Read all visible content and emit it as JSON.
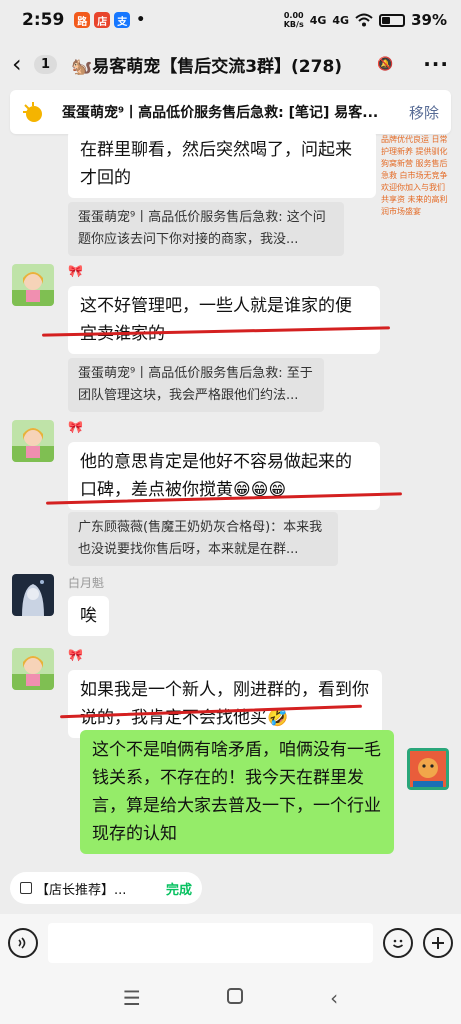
{
  "status": {
    "time": "2:59",
    "speed": "0.00\nKB/s",
    "signal1": "4G",
    "signal2": "4G",
    "battery": "39%"
  },
  "header": {
    "unread": "1",
    "title": "🐿️易客萌宠【售后交流3群】(278)",
    "more": "···"
  },
  "pinned": {
    "text": "蛋蛋萌宠⁹丨高品低价服务售后急救: [笔记] 易客...",
    "remove": "移除"
  },
  "messages": {
    "m0": {
      "text": "在群里聊看，然后突然喝了，问起来才回的"
    },
    "q0": {
      "text": "蛋蛋萌宠⁹丨高品低价服务售后急救: 这个问题你应该去问下你对接的商家，我没..."
    },
    "n1": {
      "nick": "🎀"
    },
    "m1": {
      "text": "这不好管理吧，一些人就是谁家的便宜卖谁家的"
    },
    "q1": {
      "text": "蛋蛋萌宠⁹丨高品低价服务售后急救: 至于团队管理这块，我会严格跟他们约法..."
    },
    "n2": {
      "nick": "🎀"
    },
    "m2": {
      "text": "他的意思肯定是他好不容易做起来的口碑，差点被你搅黄😁😁😁"
    },
    "q2": {
      "text": "广东顾薇薇(售魔王奶奶灰合格母)：本来我也没说要找你售后呀，本来就是在群..."
    },
    "n3": {
      "nick": "白月魁"
    },
    "m3": {
      "text": "唉"
    },
    "n4": {
      "nick": "🎀"
    },
    "m4": {
      "text": "如果我是一个新人，刚进群的，看到你说的，我肯定不会找他买🤣"
    },
    "m5": {
      "text": "这个不是咱俩有啥矛盾，咱俩没有一毛钱关系，不存在的！我今天在群里发言，算是给大家去普及一下，一个行业现存的认知"
    }
  },
  "peek_text": "品牌优代良运 日常护理新养 提供驯化狗窝新营 服务售后急救 白市场无竞争 欢迎你加入与我们共享资 未来的高利润市场盛宴",
  "quick": {
    "label": "【店长推荐】...",
    "done": "完成"
  },
  "colors": {
    "bubble_green": "#95ec69",
    "underline_red": "#d42020",
    "link_blue": "#576b95"
  }
}
